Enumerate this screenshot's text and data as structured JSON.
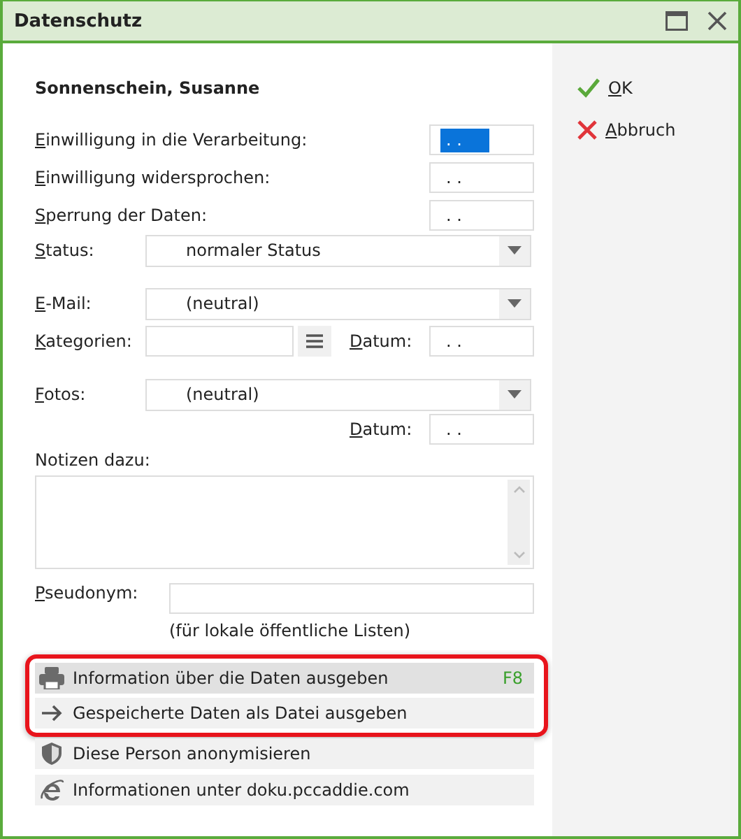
{
  "window": {
    "title": "Datenschutz"
  },
  "person_name": "Sonnenschein, Susanne",
  "date_fields": [
    {
      "label": "Einwilligung in die Verarbeitung:",
      "mnemonic": true,
      "value": ". .",
      "selected": true
    },
    {
      "label": "Einwilligung widersprochen:",
      "mnemonic": true,
      "value": ". .",
      "selected": false
    },
    {
      "label": "Sperrung der Daten:",
      "mnemonic": true,
      "value": ". .",
      "selected": false
    }
  ],
  "status": {
    "label": "Status:",
    "mnemonic": true,
    "value": "normaler Status"
  },
  "email": {
    "label": "E-Mail:",
    "mnemonic": true,
    "value": "(neutral)"
  },
  "categories": {
    "label": "Kategorien:",
    "mnemonic": true,
    "date_label": "Datum:",
    "date_value": ". ."
  },
  "photos": {
    "label": "Fotos:",
    "mnemonic": true,
    "value": "(neutral)",
    "date_label": "Datum:",
    "date_value": ". ."
  },
  "notes": {
    "label": "Notizen dazu:",
    "mnemonic": false
  },
  "pseudonym": {
    "label": "Pseudonym:",
    "mnemonic": true,
    "hint": "(für lokale öffentliche Listen)"
  },
  "highlighted_actions": [
    {
      "kind": "print",
      "label": "Information über die Daten ausgeben",
      "shortcut": "F8",
      "selected": true
    },
    {
      "kind": "export",
      "label": "Gespeicherte Daten als Datei ausgeben",
      "selected": false
    }
  ],
  "actions": [
    {
      "kind": "anonymize",
      "label": "Diese Person anonymisieren",
      "selected": false
    },
    {
      "kind": "web",
      "label": "Informationen unter doku.pccaddie.com",
      "selected": false
    }
  ],
  "buttons": [
    {
      "kind": "ok",
      "label": "OK",
      "mnemonic": true
    },
    {
      "kind": "cancel",
      "label": "Abbruch",
      "mnemonic": true
    }
  ]
}
